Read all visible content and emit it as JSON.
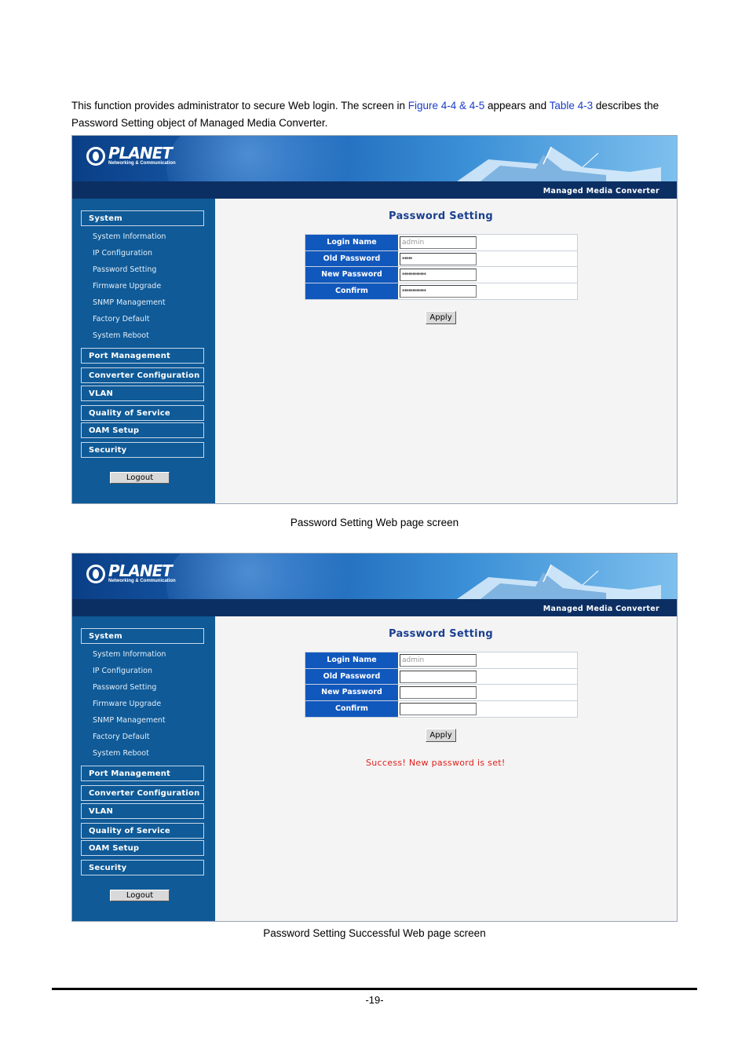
{
  "intro": {
    "part1": "This function provides administrator to secure Web login. The screen in ",
    "link1": "Figure 4-4 & 4-5",
    "part2": " appears and ",
    "link2": "Table 4-3",
    "part3": " describes the Password Setting object of Managed Media Converter."
  },
  "app": {
    "logo_name": "PLANET",
    "logo_sub": "Networking & Communication",
    "product": "Managed Media Converter",
    "sidebar": {
      "system": "System",
      "system_items": [
        "System Information",
        "IP Configuration",
        "Password Setting",
        "Firmware Upgrade",
        "SNMP Management",
        "Factory Default",
        "System Reboot"
      ],
      "sections": [
        "Port Management",
        "Converter Configuration",
        "VLAN",
        "Quality of Service",
        "OAM Setup",
        "Security"
      ],
      "logout": "Logout"
    },
    "page_title": "Password Setting",
    "labels": [
      "Login Name",
      "Old Password",
      "New Password",
      "Confirm"
    ],
    "apply": "Apply"
  },
  "screen1": {
    "login_name": "admin",
    "old_password": "*****",
    "new_password": "************",
    "confirm": "************"
  },
  "screen2": {
    "login_name": "admin",
    "old_password": "",
    "new_password": "",
    "confirm": "",
    "success": "Success! New password is set!"
  },
  "captions": {
    "fig1": "Password Setting Web page screen",
    "fig2": "Password Setting Successful Web page screen"
  },
  "page_number": "-19-"
}
